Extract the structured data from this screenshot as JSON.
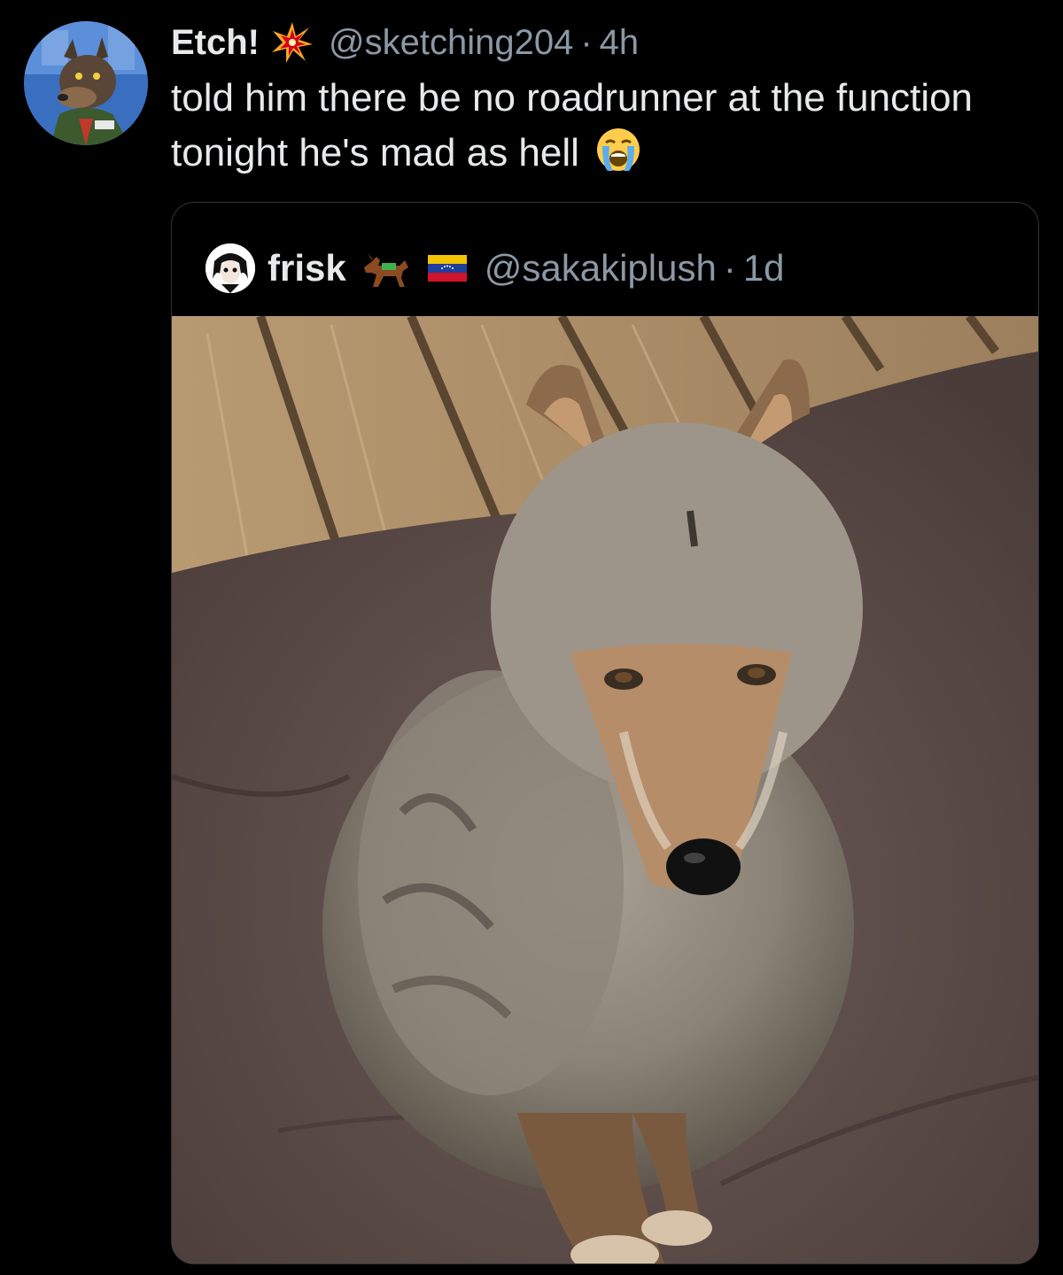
{
  "tweet": {
    "display_name": "Etch!",
    "name_emoji": "collision-emoji",
    "handle": "@sketching204",
    "separator": "·",
    "time": "4h",
    "text": "told him there be no roadrunner at the function tonight he's mad as hell",
    "text_emoji": "loudly-crying-face-emoji"
  },
  "quoted_tweet": {
    "display_name": "frisk",
    "emojis": [
      "horse-emoji",
      "venezuela-flag-emoji"
    ],
    "handle": "@sakakiplush",
    "separator": "·",
    "time": "1d",
    "media": "photo-coyote-on-cushion"
  },
  "colors": {
    "background": "#000000",
    "text_primary": "#e7e9ea",
    "text_secondary": "#8b98a5",
    "border": "#2f3336"
  }
}
